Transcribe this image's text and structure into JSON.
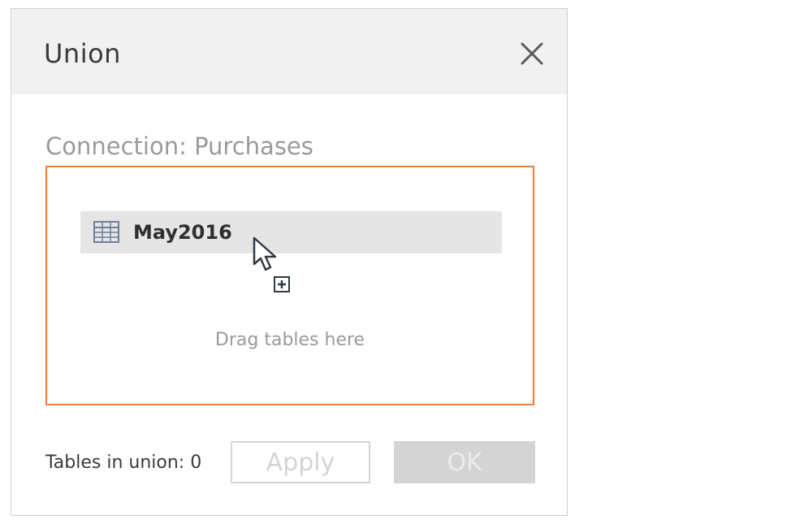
{
  "dialog": {
    "title": "Union",
    "connection_label": "Connection: Purchases",
    "dragged_table": {
      "label": "May2016",
      "icon": "table-grid-icon"
    },
    "drop_hint": "Drag tables here",
    "tables_in_union": "Tables in union: 0",
    "apply_label": "Apply",
    "ok_label": "OK",
    "close_icon": "close-icon"
  },
  "colors": {
    "accent_border": "#f07c3a",
    "titlebar_bg": "#f1f1f1",
    "disabled_text": "#d4d4d4"
  }
}
